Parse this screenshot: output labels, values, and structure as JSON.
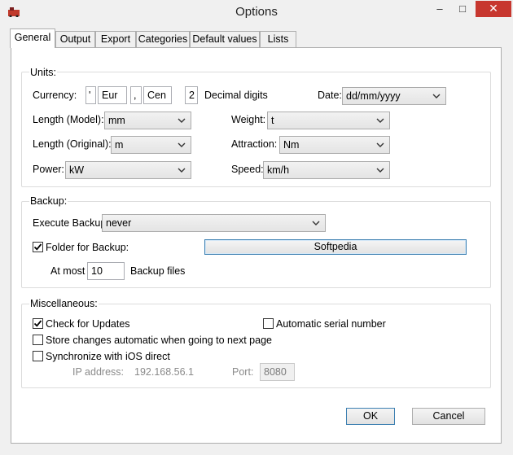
{
  "window": {
    "title": "Options",
    "minimize": "–",
    "maximize": "□",
    "close": "✕"
  },
  "tabs": [
    "General",
    "Output",
    "Export",
    "Categories",
    "Default values",
    "Lists"
  ],
  "units": {
    "legend": "Units:",
    "currency_label": "Currency:",
    "currency_symbol": "'",
    "currency_main": "Eur",
    "currency_sep": ",",
    "currency_sub": "Cen",
    "decimal_value": "2",
    "decimal_label": "Decimal digits",
    "date_label": "Date:",
    "date_value": "dd/mm/yyyy",
    "length_model_label": "Length (Model):",
    "length_model_value": "mm",
    "weight_label": "Weight:",
    "weight_value": "t",
    "length_original_label": "Length (Original):",
    "length_original_value": "m",
    "attraction_label": "Attraction:",
    "attraction_value": "Nm",
    "power_label": "Power:",
    "power_value": "kW",
    "speed_label": "Speed:",
    "speed_value": "km/h"
  },
  "backup": {
    "legend": "Backup:",
    "execute_label": "Execute Backup",
    "execute_value": "never",
    "folder_label": "Folder for Backup:",
    "folder_checked": true,
    "folder_button": "Softpedia",
    "atmost_label": "At most",
    "atmost_value": "10",
    "files_label": "Backup files"
  },
  "misc": {
    "legend": "Miscellaneous:",
    "check_updates_label": "Check for Updates",
    "check_updates_checked": true,
    "auto_serial_label": "Automatic serial number",
    "auto_serial_checked": false,
    "store_changes_label": "Store changes automatic when going to next page",
    "store_changes_checked": false,
    "sync_ios_label": "Synchronize with iOS direct",
    "sync_ios_checked": false,
    "ip_label": "IP address:",
    "ip_value": "192.168.56.1",
    "port_label": "Port:",
    "port_value": "8080"
  },
  "buttons": {
    "ok": "OK",
    "cancel": "Cancel"
  },
  "icons": {
    "app": "app-icon",
    "minimize": "minimize-icon",
    "maximize": "maximize-icon",
    "close": "close-icon",
    "dropdown": "chevron-down-icon",
    "checkmark": "checkmark-icon"
  }
}
